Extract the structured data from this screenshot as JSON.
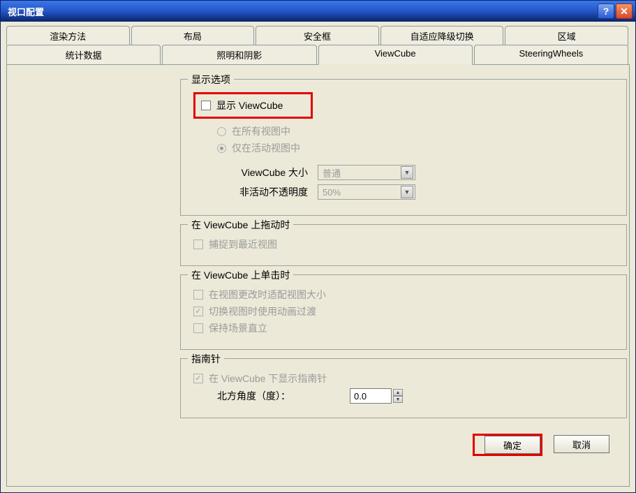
{
  "window": {
    "title": "视口配置"
  },
  "tabs_top": [
    "渲染方法",
    "布局",
    "安全框",
    "自适应降级切换",
    "区域"
  ],
  "tabs_bottom": [
    "统计数据",
    "照明和阴影",
    "ViewCube",
    "SteeringWheels"
  ],
  "group_display": {
    "legend": "显示选项",
    "show_viewcube": "显示 ViewCube",
    "in_all_views": "在所有视图中",
    "in_active_view": "仅在活动视图中",
    "size_label": "ViewCube 大小",
    "size_value": "普通",
    "opacity_label": "非活动不透明度",
    "opacity_value": "50%"
  },
  "group_drag": {
    "legend": "在 ViewCube 上拖动时",
    "snap": "捕捉到最近视图"
  },
  "group_click": {
    "legend": "在 ViewCube 上单击时",
    "fit_view": "在视图更改时适配视图大小",
    "animate": "切换视图时使用动画过渡",
    "keep_upright": "保持场景直立"
  },
  "group_compass": {
    "legend": "指南针",
    "show_compass": "在 ViewCube 下显示指南针",
    "north_label": "北方角度（度）：",
    "north_value": "0.0"
  },
  "buttons": {
    "ok": "确定",
    "cancel": "取消"
  }
}
